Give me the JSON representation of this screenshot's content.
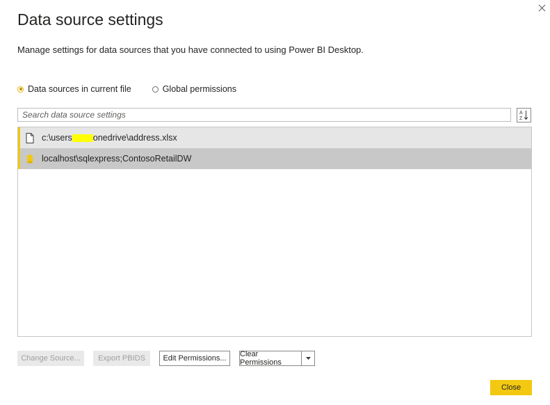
{
  "dialog": {
    "title": "Data source settings",
    "subtitle": "Manage settings for data sources that you have connected to using Power BI Desktop."
  },
  "scope": {
    "options": [
      {
        "label": "Data sources in current file",
        "selected": true
      },
      {
        "label": "Global permissions",
        "selected": false
      }
    ]
  },
  "search": {
    "placeholder": "Search data source settings"
  },
  "sources": [
    {
      "prefix": "c:\\users",
      "suffix": "onedrive\\address.xlsx",
      "icon": "file-icon",
      "redacted": true
    },
    {
      "label": "localhost\\sqlexpress;ContosoRetailDW",
      "icon": "database-icon"
    }
  ],
  "buttons": {
    "change_source": "Change Source...",
    "export_pbids": "Export PBIDS",
    "edit_permissions": "Edit Permissions...",
    "clear_permissions": "Clear Permissions",
    "close": "Close"
  },
  "colors": {
    "accent": "#f2c811",
    "selected_row": "#c8c8c8",
    "hover_row": "#e6e6e6",
    "redaction": "#ffff00"
  },
  "icons": {
    "window_close": "close-icon",
    "sort": "sort-az-icon",
    "dropdown": "chevron-down-icon"
  }
}
